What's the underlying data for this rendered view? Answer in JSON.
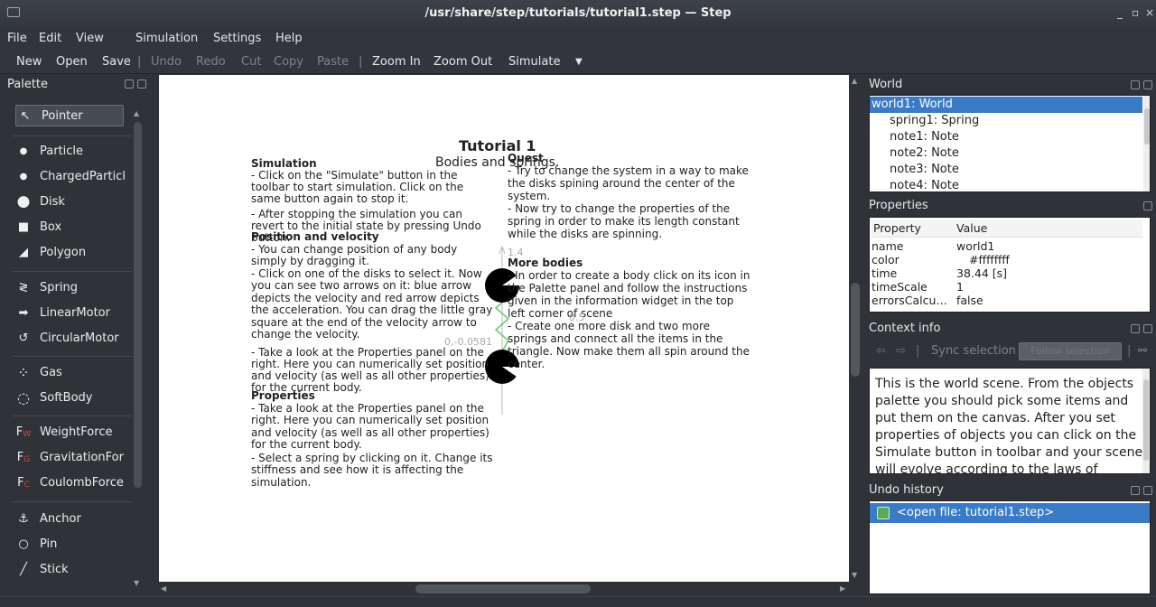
{
  "window": {
    "title": "/usr/share/step/tutorials/tutorial1.step — Step",
    "controls": [
      "_",
      "▫",
      "×"
    ]
  },
  "menu": [
    "File",
    "Edit",
    "View",
    "Simulation",
    "Settings",
    "Help"
  ],
  "toolbar": {
    "items": [
      "New",
      "Open",
      "Save",
      "Undo",
      "Redo",
      "Cut",
      "Copy",
      "Paste",
      "Zoom In",
      "Zoom Out",
      "Simulate"
    ],
    "separator": "|",
    "more": "▼"
  },
  "palette": {
    "title": "Palette",
    "items": [
      "Pointer",
      "Particle",
      "ChargedParticl",
      "Disk",
      "Box",
      "Polygon",
      "Spring",
      "LinearMotor",
      "CircularMotor",
      "Gas",
      "SoftBody",
      "WeightForce",
      "GravitationFor",
      "CoulombForce",
      "Anchor",
      "Pin",
      "Stick"
    ],
    "icons": {
      "pointer": "↖",
      "particle": "●",
      "charged": "●",
      "disk": "●",
      "box": "■",
      "polygon": "◢",
      "spring": "≷",
      "linear": "➡",
      "circular": "↺",
      "gas": "⁘",
      "softbody": "◌",
      "weight": "F",
      "weight_sub": "W",
      "gravitation": "F",
      "gravitation_sub": "G",
      "coulomb": "F",
      "coulomb_sub": "C",
      "anchor": "⚓",
      "pin": "○",
      "stick": "╱"
    }
  },
  "canvas": {
    "title": "Tutorial 1",
    "subtitle": "Bodies and springs.",
    "simulation": {
      "heading": "Simulation",
      "lines": [
        "- Click on the \"Simulate\" button in the",
        "toolbar to start simulation. Click on the",
        "same button again to stop it.",
        "- After stopping the simulation you can",
        "revert to the initial state by pressing Undo",
        "button."
      ]
    },
    "position": {
      "heading": "Position and velocity",
      "lines": [
        "- You can change position of any body",
        "simply by dragging it.",
        "- Click on one of the disks to select it. Now",
        "you can see two arrows on it: blue arrow",
        "depicts the velocity and red arrow depicts",
        "the acceleration. You can drag the little gray",
        "square at the end of the velocity arrow to",
        "change the velocity.",
        "- Take a look at the Properties panel on the",
        "right. Here you can numerically set position",
        "and velocity (as well as all other properties)",
        "for the current body."
      ]
    },
    "properties": {
      "heading": "Properties",
      "lines": [
        "- Take a look at the Properties panel on the",
        "right. Here you can numerically set position",
        "and velocity (as well as all other properties)",
        "for the current body.",
        "- Select a spring by clicking on it. Change its",
        "stiffness and see how it is affecting the",
        "simulation."
      ]
    },
    "quest": {
      "heading": "Quest",
      "lines": [
        "- Try to change the system in a way to make",
        "the disks spining around the center of the",
        "system.",
        "- Now try to change the properties of the",
        "spring in order to make its length constant",
        "while the disks are spinning."
      ]
    },
    "more": {
      "heading": "More bodies",
      "lines": [
        "- In order to create a body click on its icon in",
        "the Palette panel and follow the instructions",
        "given in the information widget in the top",
        "left corner of scene",
        "- Create one more disk and two more",
        "springs and connect all the items in the",
        "triangle. Now make them all spin around the",
        "center."
      ]
    },
    "axis": {
      "y_tick": "1.4",
      "origin": "0,-0.0581",
      "mid": "0.5"
    }
  },
  "world": {
    "title": "World",
    "items": [
      "world1: World",
      "spring1: Spring",
      "note1: Note",
      "note2: Note",
      "note3: Note",
      "note4: Note"
    ]
  },
  "properties": {
    "title": "Properties",
    "header": [
      "Property",
      "Value"
    ],
    "rows": [
      [
        "name",
        "world1"
      ],
      [
        "color",
        "#ffffffff"
      ],
      [
        "time",
        "38.44 [s]"
      ],
      [
        "timeScale",
        "1"
      ],
      [
        "errorsCalcu…",
        "false"
      ]
    ]
  },
  "context": {
    "title": "Context info",
    "sync": "Sync selection",
    "follow": "Follow selection",
    "text": "This is the world scene. From the objects palette you should pick some items and put them on the canvas. After you set properties of objects you can click on the Simulate button in toolbar and your scene will evolve according to the laws of physics."
  },
  "undo": {
    "title": "Undo history",
    "items": [
      "<open file: tutorial1.step>"
    ]
  }
}
